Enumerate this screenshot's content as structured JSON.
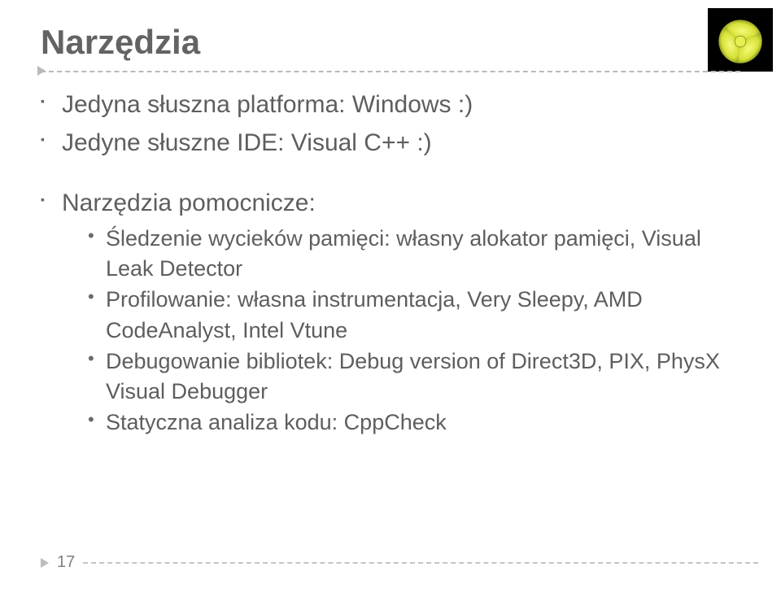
{
  "title": "Narzędzia",
  "bullets": {
    "b1": "Jedyna słuszna platforma: Windows :)",
    "b2": "Jedyne słuszne IDE: Visual C++ :)",
    "b3": "Narzędzia pomocnicze:"
  },
  "sub": {
    "s1": "Śledzenie wycieków pamięci: własny alokator pamięci, Visual Leak Detector",
    "s2": "Profilowanie: własna instrumentacja, Very Sleepy, AMD CodeAnalyst, Intel Vtune",
    "s3": "Debugowanie bibliotek: Debug version of Direct3D, PIX, PhysX Visual Debugger",
    "s4": "Statyczna analiza kodu: CppCheck"
  },
  "page_number": "17"
}
